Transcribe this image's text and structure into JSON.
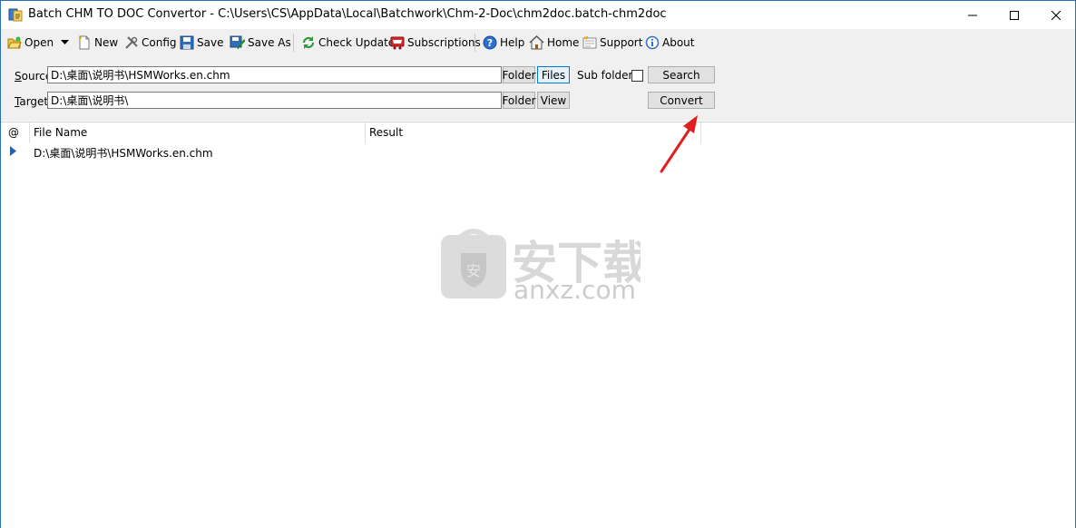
{
  "window": {
    "title": "Batch CHM TO DOC Convertor - C:\\Users\\CS\\AppData\\Local\\Batchwork\\Chm-2-Doc\\chm2doc.batch-chm2doc"
  },
  "toolbar": {
    "open": "Open",
    "new": "New",
    "config": "Config",
    "save": "Save",
    "save_as": "Save As",
    "check_update": "Check Update",
    "subscriptions": "Subscriptions",
    "help": "Help",
    "home": "Home",
    "support": "Support",
    "about": "About"
  },
  "source": {
    "label_accel": "S",
    "label_rest": "ource",
    "value": "D:\\桌面\\说明书\\HSMWorks.en.chm",
    "folder_btn": "Folder",
    "files_btn": "Files",
    "subfolders_label": "Sub folders",
    "subfolders_checked": false,
    "search_btn": "Search"
  },
  "target": {
    "label_accel": "T",
    "label_rest": "arget",
    "value": "D:\\桌面\\说明书\\",
    "folder_btn": "Folder",
    "view_btn": "View",
    "convert_btn": "Convert"
  },
  "grid": {
    "columns": [
      "@",
      "File Name",
      "Result"
    ],
    "rows": [
      {
        "file": "D:\\桌面\\说明书\\HSMWorks.en.chm",
        "result": ""
      }
    ]
  },
  "watermark": {
    "cn": "安下载",
    "en": "anxz.com"
  },
  "colors": {
    "accent": "#0078d7",
    "annotation_arrow": "#e02020"
  }
}
